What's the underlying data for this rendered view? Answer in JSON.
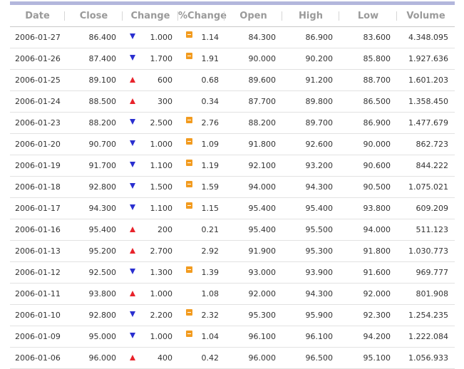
{
  "headers": [
    "Date",
    "Close",
    "Change",
    "%Change",
    "Open",
    "High",
    "Low",
    "Volume"
  ],
  "colors": {
    "up": "#e8232b",
    "down": "#2a2fd0",
    "minus_badge": "#f29b1f",
    "top_bar": "#b3b7dc"
  },
  "rows": [
    {
      "date": "2006-01-27",
      "close": "86.400",
      "dir": "down",
      "change": "1.000",
      "pct": "1.14",
      "open": "84.300",
      "high": "86.900",
      "low": "83.600",
      "volume": "4.348.095"
    },
    {
      "date": "2006-01-26",
      "close": "87.400",
      "dir": "down",
      "change": "1.700",
      "pct": "1.91",
      "open": "90.000",
      "high": "90.200",
      "low": "85.800",
      "volume": "1.927.636"
    },
    {
      "date": "2006-01-25",
      "close": "89.100",
      "dir": "up",
      "change": "600",
      "pct": "0.68",
      "open": "89.600",
      "high": "91.200",
      "low": "88.700",
      "volume": "1.601.203"
    },
    {
      "date": "2006-01-24",
      "close": "88.500",
      "dir": "up",
      "change": "300",
      "pct": "0.34",
      "open": "87.700",
      "high": "89.800",
      "low": "86.500",
      "volume": "1.358.450"
    },
    {
      "date": "2006-01-23",
      "close": "88.200",
      "dir": "down",
      "change": "2.500",
      "pct": "2.76",
      "open": "88.200",
      "high": "89.700",
      "low": "86.900",
      "volume": "1.477.679"
    },
    {
      "date": "2006-01-20",
      "close": "90.700",
      "dir": "down",
      "change": "1.000",
      "pct": "1.09",
      "open": "91.800",
      "high": "92.600",
      "low": "90.000",
      "volume": "862.723"
    },
    {
      "date": "2006-01-19",
      "close": "91.700",
      "dir": "down",
      "change": "1.100",
      "pct": "1.19",
      "open": "92.100",
      "high": "93.200",
      "low": "90.600",
      "volume": "844.222"
    },
    {
      "date": "2006-01-18",
      "close": "92.800",
      "dir": "down",
      "change": "1.500",
      "pct": "1.59",
      "open": "94.000",
      "high": "94.300",
      "low": "90.500",
      "volume": "1.075.021"
    },
    {
      "date": "2006-01-17",
      "close": "94.300",
      "dir": "down",
      "change": "1.100",
      "pct": "1.15",
      "open": "95.400",
      "high": "95.400",
      "low": "93.800",
      "volume": "609.209"
    },
    {
      "date": "2006-01-16",
      "close": "95.400",
      "dir": "up",
      "change": "200",
      "pct": "0.21",
      "open": "95.400",
      "high": "95.500",
      "low": "94.000",
      "volume": "511.123"
    },
    {
      "date": "2006-01-13",
      "close": "95.200",
      "dir": "up",
      "change": "2.700",
      "pct": "2.92",
      "open": "91.900",
      "high": "95.300",
      "low": "91.800",
      "volume": "1.030.773"
    },
    {
      "date": "2006-01-12",
      "close": "92.500",
      "dir": "down",
      "change": "1.300",
      "pct": "1.39",
      "open": "93.000",
      "high": "93.900",
      "low": "91.600",
      "volume": "969.777"
    },
    {
      "date": "2006-01-11",
      "close": "93.800",
      "dir": "up",
      "change": "1.000",
      "pct": "1.08",
      "open": "92.000",
      "high": "94.300",
      "low": "92.000",
      "volume": "801.908"
    },
    {
      "date": "2006-01-10",
      "close": "92.800",
      "dir": "down",
      "change": "2.200",
      "pct": "2.32",
      "open": "95.300",
      "high": "95.900",
      "low": "92.300",
      "volume": "1.254.235"
    },
    {
      "date": "2006-01-09",
      "close": "95.000",
      "dir": "down",
      "change": "1.000",
      "pct": "1.04",
      "open": "96.100",
      "high": "96.100",
      "low": "94.200",
      "volume": "1.222.084"
    },
    {
      "date": "2006-01-06",
      "close": "96.000",
      "dir": "up",
      "change": "400",
      "pct": "0.42",
      "open": "96.000",
      "high": "96.500",
      "low": "95.100",
      "volume": "1.056.933"
    }
  ]
}
